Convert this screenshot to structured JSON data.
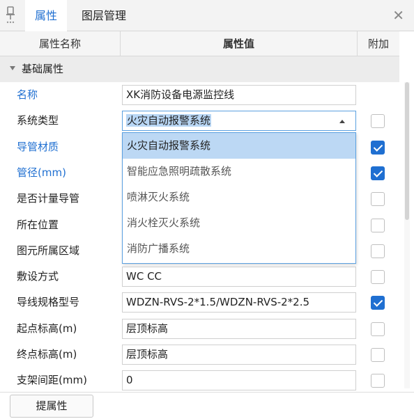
{
  "tabs": [
    {
      "label": "属性",
      "active": true
    },
    {
      "label": "图层管理",
      "active": false
    }
  ],
  "columns": {
    "name": "属性名称",
    "value": "属性值",
    "extra": "附加"
  },
  "group_label": "基础属性",
  "rows": [
    {
      "name": "名称",
      "value": "XK消防设备电源监控线",
      "blue": true,
      "checkbox": false,
      "has_checkbox": false
    },
    {
      "name": "系统类型",
      "value": "火灾自动报警系统",
      "blue": false,
      "checkbox": false,
      "has_checkbox": true
    },
    {
      "name": "导管材质",
      "value": "",
      "blue": true,
      "checkbox": true,
      "has_checkbox": true
    },
    {
      "name": "管径(mm)",
      "value": "",
      "blue": true,
      "checkbox": true,
      "has_checkbox": true
    },
    {
      "name": "是否计量导管",
      "value": "",
      "blue": false,
      "checkbox": false,
      "has_checkbox": true
    },
    {
      "name": "所在位置",
      "value": "",
      "blue": false,
      "checkbox": false,
      "has_checkbox": true
    },
    {
      "name": "图元所属区域",
      "value": "",
      "blue": false,
      "checkbox": false,
      "has_checkbox": true
    },
    {
      "name": "敷设方式",
      "value": "WC CC",
      "blue": false,
      "checkbox": false,
      "has_checkbox": true
    },
    {
      "name": "导线规格型号",
      "value": "WDZN-RVS-2*1.5/WDZN-RVS-2*2.5",
      "blue": false,
      "checkbox": true,
      "has_checkbox": true
    },
    {
      "name": "起点标高(m)",
      "value": "层顶标高",
      "blue": false,
      "checkbox": false,
      "has_checkbox": true
    },
    {
      "name": "终点标高(m)",
      "value": "层顶标高",
      "blue": false,
      "checkbox": false,
      "has_checkbox": true
    },
    {
      "name": "支架间距(mm)",
      "value": "0",
      "blue": false,
      "checkbox": false,
      "has_checkbox": true
    }
  ],
  "dropdown": {
    "selected": "火灾自动报警系统",
    "options": [
      "火灾自动报警系统",
      "智能应急照明疏散系统",
      "喷淋灭火系统",
      "消火栓灭火系统",
      "消防广播系统"
    ]
  },
  "footer": {
    "button_label": "提属性"
  },
  "icons": {
    "pin": "pin-icon",
    "close": "close-icon",
    "collapse": "triangle-down-icon",
    "dropdown": "caret-up-icon"
  },
  "colors": {
    "accent": "#1f6fd1",
    "selection": "#bcd8f4",
    "header_bg": "#f5f5f5",
    "group_bg": "#ececec"
  }
}
